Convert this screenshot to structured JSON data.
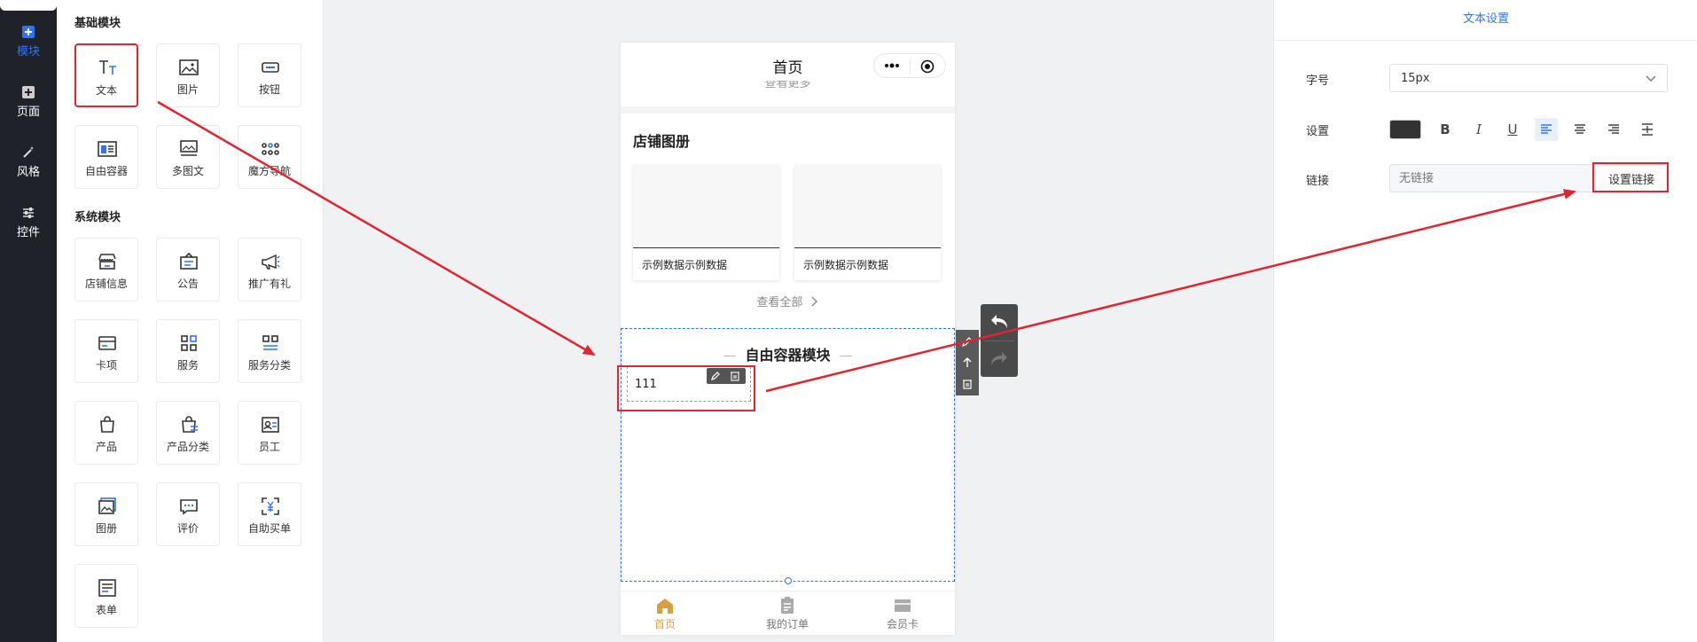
{
  "leftnav": {
    "items": [
      {
        "label": "模块",
        "icon": "plus-square-icon"
      },
      {
        "label": "页面",
        "icon": "plus-square-icon"
      },
      {
        "label": "风格",
        "icon": "magic-wand-icon"
      },
      {
        "label": "控件",
        "icon": "sliders-icon"
      }
    ],
    "active_color": "#2f74f5"
  },
  "modules": {
    "basic_title": "基础模块",
    "basic": [
      "文本",
      "图片",
      "按钮",
      "自由容器",
      "多图文",
      "魔方导航"
    ],
    "system_title": "系统模块",
    "system": [
      "店铺信息",
      "公告",
      "推广有礼",
      "卡项",
      "服务",
      "服务分类",
      "产品",
      "产品分类",
      "员工",
      "图册",
      "评价",
      "自助买单",
      "表单"
    ]
  },
  "phone": {
    "title": "首页",
    "partial_link": "查看更多",
    "album_title": "店铺图册",
    "cards": [
      "示例数据示例数据",
      "示例数据示例数据"
    ],
    "view_all": "查看全部",
    "free_container_title": "自由容器模块",
    "text_value": "111",
    "tabs": [
      "首页",
      "我的订单",
      "会员卡"
    ],
    "tab_active_color": "#d8a040"
  },
  "settings": {
    "header": "文本设置",
    "font_size_label": "字号",
    "font_size_value": "15px",
    "style_label": "设置",
    "color_value": "#333333",
    "format_buttons": [
      "B",
      "I",
      "U"
    ],
    "link_label": "链接",
    "link_placeholder": "无链接",
    "link_button": "设置链接"
  },
  "annotation_color": "#e02430"
}
